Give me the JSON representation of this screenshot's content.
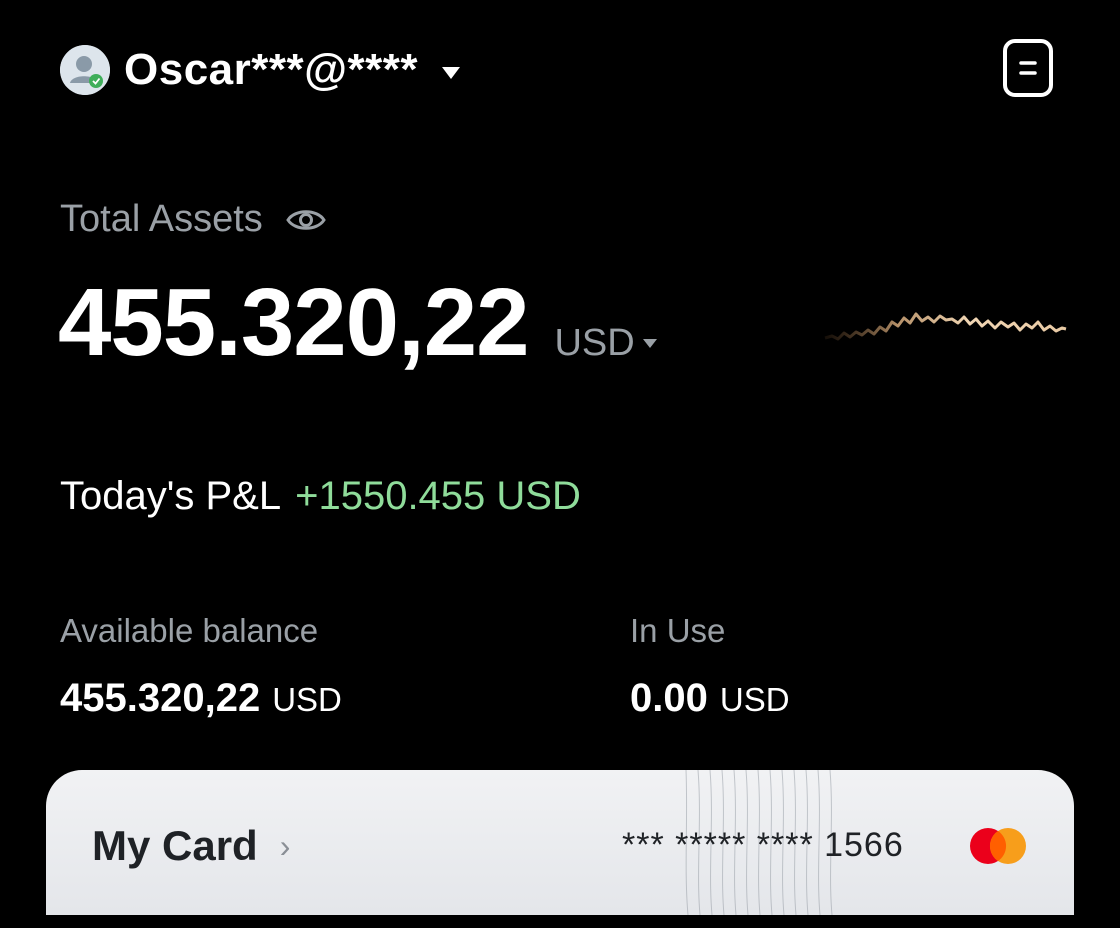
{
  "header": {
    "account_name": "Oscar***@****",
    "avatar_icon": "user-avatar-icon",
    "menu_icon": "document-icon"
  },
  "assets": {
    "label": "Total Assets",
    "value": "455.320,22",
    "currency": "USD",
    "visibility_icon": "eye-icon"
  },
  "pnl": {
    "label": "Today's P&L",
    "value": "+1550.455 USD",
    "color": "#8fdc9a"
  },
  "balances": {
    "available_label": "Available balance",
    "available_value": "455.320,22",
    "available_currency": "USD",
    "in_use_label": "In Use",
    "in_use_value": "0.00",
    "in_use_currency": "USD"
  },
  "card": {
    "title": "My Card",
    "chevron": "›",
    "number": "*** ***** **** 1566",
    "brand_icon": "mastercard-icon"
  }
}
